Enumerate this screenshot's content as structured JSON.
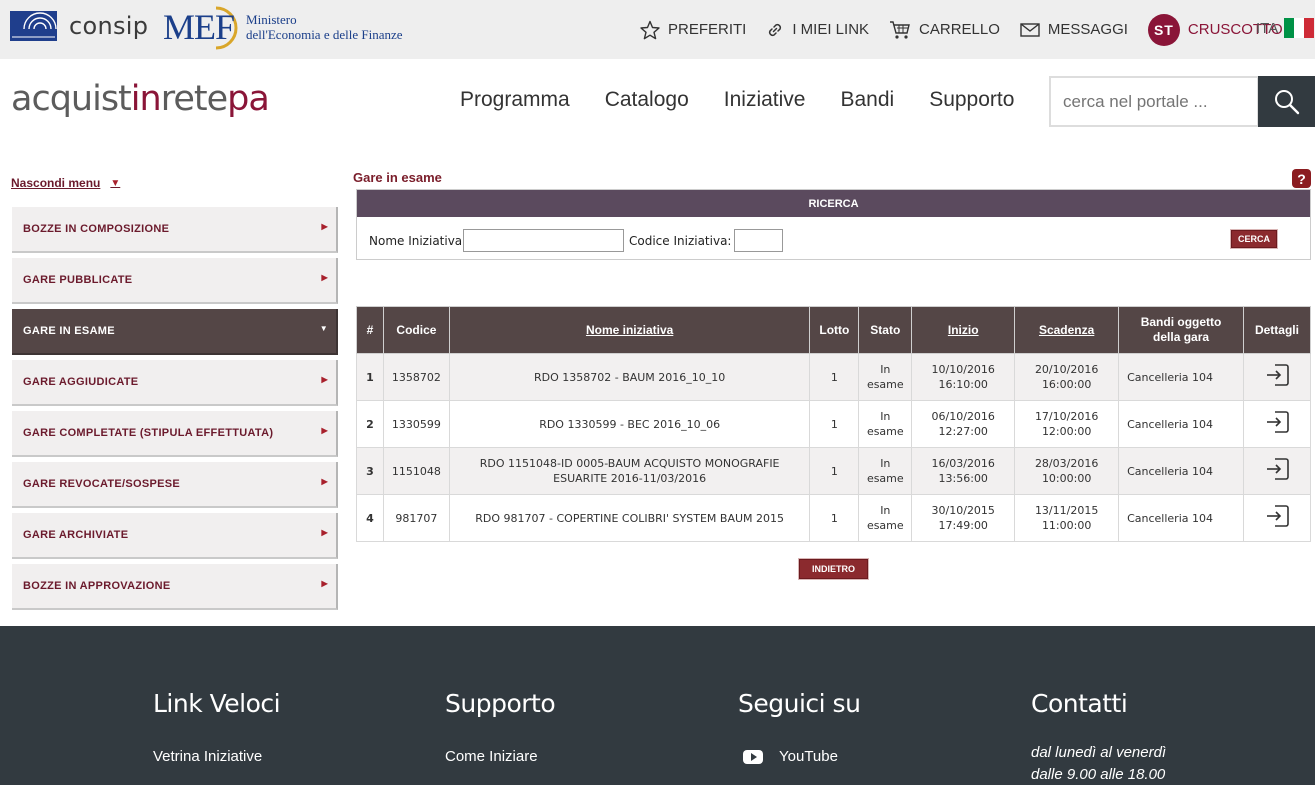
{
  "topbar": {
    "consip": "consip",
    "mef": "MEF",
    "mef_sub1": "Ministero",
    "mef_sub2": "dell'Economia e delle Finanze",
    "links": {
      "preferiti": "PREFERITI",
      "miei_link": "I MIEI LINK",
      "carrello": "CARRELLO",
      "messaggi": "MESSAGGI",
      "cruscotto": "CRUSCOTTO"
    },
    "avatar": "ST",
    "lang": "ITA",
    "flag_colors": [
      "#009246",
      "#ffffff",
      "#ce2b37"
    ]
  },
  "header": {
    "brand_a": "acquist",
    "brand_b": "in",
    "brand_c": "rete",
    "brand_d": "pa",
    "nav": [
      "Programma",
      "Catalogo",
      "Iniziative",
      "Bandi",
      "Supporto"
    ],
    "search_placeholder": "cerca nel portale ..."
  },
  "sidebar": {
    "hide_label": "Nascondi menu",
    "items": [
      "BOZZE IN COMPOSIZIONE",
      "GARE PUBBLICATE",
      "GARE IN ESAME",
      "GARE AGGIUDICATE",
      "GARE COMPLETATE (STIPULA EFFETTUATA)",
      "GARE REVOCATE/SOSPESE",
      "GARE ARCHIVIATE",
      "BOZZE IN APPROVAZIONE"
    ],
    "active_index": 2
  },
  "content": {
    "title": "Gare in esame",
    "help": "?",
    "search": {
      "header": "RICERCA",
      "label_nome": "Nome Iniziativa",
      "label_codice": "Codice Iniziativa:",
      "nome_value": "",
      "codice_value": "",
      "button": "CERCA"
    },
    "table": {
      "headers": [
        "#",
        "Codice",
        "Nome iniziativa",
        "Lotto",
        "Stato",
        "Inizio",
        "Scadenza",
        "Bandi oggetto della gara",
        "Dettagli"
      ],
      "rows": [
        {
          "n": "1",
          "codice": "1358702",
          "nome": "RDO 1358702 - BAUM 2016_10_10",
          "lotto": "1",
          "stato1": "In",
          "stato2": "esame",
          "inizio1": "10/10/2016",
          "inizio2": "16:10:00",
          "scad1": "20/10/2016",
          "scad2": "16:00:00",
          "bandi": "Cancelleria 104"
        },
        {
          "n": "2",
          "codice": "1330599",
          "nome": "RDO 1330599 - BEC 2016_10_06",
          "lotto": "1",
          "stato1": "In",
          "stato2": "esame",
          "inizio1": "06/10/2016",
          "inizio2": "12:27:00",
          "scad1": "17/10/2016",
          "scad2": "12:00:00",
          "bandi": "Cancelleria 104"
        },
        {
          "n": "3",
          "codice": "1151048",
          "nome": "RDO 1151048-ID 0005-BAUM ACQUISTO MONOGRAFIE ESUARITE 2016-11/03/2016",
          "lotto": "1",
          "stato1": "In",
          "stato2": "esame",
          "inizio1": "16/03/2016",
          "inizio2": "13:56:00",
          "scad1": "28/03/2016",
          "scad2": "10:00:00",
          "bandi": "Cancelleria 104"
        },
        {
          "n": "4",
          "codice": "981707",
          "nome": "RDO 981707 - COPERTINE COLIBRI' SYSTEM BAUM 2015",
          "lotto": "1",
          "stato1": "In",
          "stato2": "esame",
          "inizio1": "30/10/2015",
          "inizio2": "17:49:00",
          "scad1": "13/11/2015",
          "scad2": "11:00:00",
          "bandi": "Cancelleria 104"
        }
      ]
    },
    "back_button": "INDIETRO"
  },
  "footer": {
    "col1": {
      "title": "Link Veloci",
      "link": "Vetrina Iniziative"
    },
    "col2": {
      "title": "Supporto",
      "link": "Come Iniziare"
    },
    "col3": {
      "title": "Seguici su",
      "link": "YouTube"
    },
    "col4": {
      "title": "Contatti",
      "line1": "dal lunedì al venerdì",
      "line2": "dalle 9.00 alle 18.00"
    }
  },
  "colors": {
    "brand": "#8a1538",
    "header_dark": "#544646",
    "footer": "#323a40"
  }
}
